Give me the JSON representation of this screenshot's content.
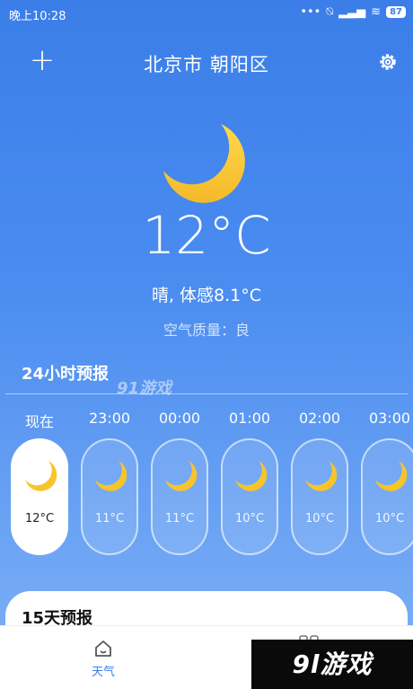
{
  "status_bar": {
    "time": "晚上10:28",
    "battery": "87"
  },
  "header": {
    "add_label": "+",
    "city": "北京市  朝阳区"
  },
  "current": {
    "temperature": "12°C",
    "condition": "晴, 体感8.1°C",
    "air_quality": "空气质量：良"
  },
  "hourly": {
    "title": "24小时预报",
    "items": [
      {
        "time": "现在",
        "temp": "12°C",
        "icon": "moon-icon",
        "active": true
      },
      {
        "time": "23:00",
        "temp": "11°C",
        "icon": "moon-icon"
      },
      {
        "time": "00:00",
        "temp": "11°C",
        "icon": "moon-icon"
      },
      {
        "time": "01:00",
        "temp": "10°C",
        "icon": "moon-icon"
      },
      {
        "time": "02:00",
        "temp": "10°C",
        "icon": "moon-icon"
      },
      {
        "time": "03:00",
        "temp": "10°C",
        "icon": "moon-icon"
      }
    ]
  },
  "forecast": {
    "title": "15天预报"
  },
  "nav": {
    "weather_label": "天气"
  },
  "watermarks": {
    "mid": "91游戏",
    "brand": "9l游戏"
  },
  "colors": {
    "accent": "#3b7ee8",
    "moon": "#f7c52a"
  }
}
